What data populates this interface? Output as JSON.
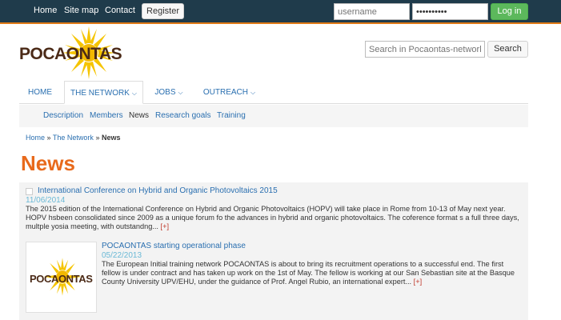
{
  "topbar": {
    "links": [
      "Home",
      "Site map",
      "Contact"
    ],
    "register_label": "Register",
    "username_placeholder": "username",
    "password_value": "••••••••••",
    "login_label": "Log in"
  },
  "logo": {
    "text": "POCAONTAS"
  },
  "search": {
    "placeholder": "Search in Pocaontas-network.eu",
    "button_label": "Search"
  },
  "main_nav": [
    {
      "label": "HOME"
    },
    {
      "label": "THE NETWORK",
      "active": true
    },
    {
      "label": "JOBS"
    },
    {
      "label": "OUTREACH"
    }
  ],
  "sub_nav": [
    "Description",
    "Members",
    "News",
    "Research goals",
    "Training"
  ],
  "breadcrumb": {
    "home": "Home",
    "sep": "»",
    "network": "The Network",
    "current": "News"
  },
  "page_title": "News",
  "news": [
    {
      "title": "International Conference on Hybrid and Organic Photovoltaics 2015",
      "date": "11/06/2014",
      "body": "The 2015 edition of the International Conference on Hybrid and Organic Photovoltaics (HOPV) will take place in Rome from 10-13 of May next year.   HOPV hsbeen consolidated since 2009 as a unique forum fo the advances in hybrid and organic photovoltaics. The coference format s a full three days, multple yosia meeting, with outstandng...",
      "more": "[+]"
    },
    {
      "title": "POCAONTAS starting operational phase",
      "date": "05/22/2013",
      "body": "The European Initial training network POCAONTAS is about to bring its recruitment operations to a successful end. The first fellow is under contract and has taken up work on the 1st of May. The fellow is working at our San Sebastian site at the Basque County University UPV/EHU, under the guidance of Prof. Angel Rubio, an international expert...",
      "more": "[+]",
      "thumb_text": "POCAONTAS"
    }
  ],
  "colors": {
    "topbar": "#1f3b4b",
    "accent_orange": "#e86a1c",
    "link_blue": "#2a6fb0",
    "login_green": "#5cb85c",
    "logo_brown": "#4b2a17",
    "sun_yellow": "#f5c400"
  }
}
